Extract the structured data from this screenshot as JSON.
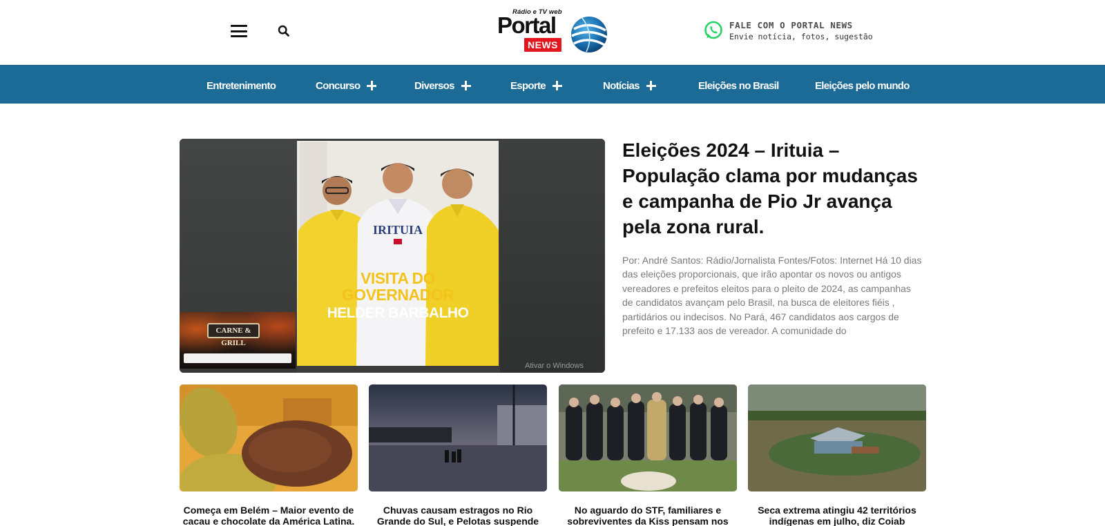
{
  "header": {
    "logo": {
      "tagline": "Rádio e TV web",
      "portal": "Portal",
      "news": "NEWS"
    },
    "contact": {
      "title": "FALE COM O PORTAL NEWS",
      "subtitle": "Envie notícia, fotos, sugestão",
      "icon": "whatsapp-icon"
    },
    "icons": [
      "menu-icon",
      "search-icon"
    ]
  },
  "nav": {
    "items": [
      {
        "label": "Entretenimento",
        "has_submenu": false
      },
      {
        "label": "Concurso",
        "has_submenu": true
      },
      {
        "label": "Diversos",
        "has_submenu": true
      },
      {
        "label": "Esporte",
        "has_submenu": true
      },
      {
        "label": "Notícias",
        "has_submenu": true
      },
      {
        "label": "Eleições no Brasil",
        "has_submenu": false
      },
      {
        "label": "Eleições pelo mundo",
        "has_submenu": false
      }
    ],
    "background": "#1c6b96"
  },
  "featured": {
    "title": "Eleições 2024 – Irituia – População clama por mudanças e campanha de Pio Jr avança pela zona rural.",
    "excerpt": "Por: André Santos: Rádio/Jornalista Fontes/Fotos: Internet Há 10 dias das eleições proporcionais, que irão apontar os novos ou antigos vereadores e prefeitos eleitos para o pleito de 2024, as campanhas de candidatos avançam pelo Brasil, na busca de eleitores fiéis , partidários ou indecisos. No Pará, 467 candidatos aos cargos de prefeito e 17.133 aos de vereador. A comunidade do",
    "image": {
      "shirt_text": "IRITUIA",
      "overlay_line1": "VISITA DO",
      "overlay_line2": "GOVERNADOR",
      "overlay_line3": "HELDER BARBALHO",
      "ad_title": "CARNE & GRILL",
      "watermark": "Ativar o Windows"
    }
  },
  "cards": [
    {
      "title": "Começa em Belém – Maior evento de cacau e chocolate da América Latina."
    },
    {
      "title": "Chuvas causam estragos no Rio Grande do Sul, e Pelotas suspende"
    },
    {
      "title": "No aguardo do STF, familiares e sobreviventes da Kiss pensam nos"
    },
    {
      "title": "Seca extrema atingiu 42 territórios indígenas em julho, diz Coiab"
    }
  ],
  "colors": {
    "nav": "#1c6b96",
    "news_red": "#e3161e",
    "whatsapp": "#25d366",
    "excerpt": "#7a7a7a"
  }
}
